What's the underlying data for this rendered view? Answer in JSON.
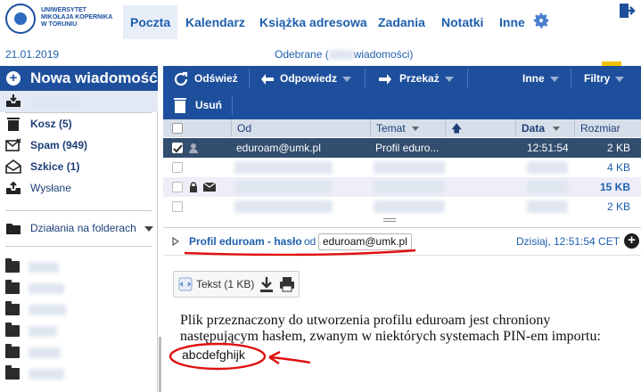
{
  "logo": {
    "lines": [
      "UNIWERSYTET",
      "MIKOŁAJA KOPERNIKA",
      "W TORUNIU"
    ]
  },
  "nav": {
    "tabs": [
      {
        "label": "Poczta"
      },
      {
        "label": "Kalendarz"
      },
      {
        "label": "Książka adresowa"
      },
      {
        "label": "Zadania"
      },
      {
        "label": "Notatki"
      },
      {
        "label": "Inne"
      }
    ]
  },
  "subbar": {
    "date": "21.01.2019",
    "mailbox_prefix": "Odebrane (",
    "mailbox_suffix": "wiadomości)"
  },
  "sidebar": {
    "new_message": "Nowa wiadomość",
    "folders": [
      {
        "label": "Kosz (5)"
      },
      {
        "label": "Spam (949)"
      },
      {
        "label": "Szkice (1)"
      },
      {
        "label": "Wysłane"
      }
    ],
    "actions_label": "Działania na folderach"
  },
  "toolbar": {
    "refresh": "Odśwież",
    "reply": "Odpowiedz",
    "forward": "Przekaż",
    "other": "Inne",
    "filters": "Filtry",
    "delete": "Usuń"
  },
  "table": {
    "headers": {
      "from": "Od",
      "subject": "Temat",
      "date": "Data",
      "size": "Rozmiar"
    },
    "rows": [
      {
        "from": "eduroam@umk.pl",
        "subject": "Profil eduro...",
        "date": "12:51:54",
        "size": "2 KB"
      },
      {
        "from": "",
        "subject": "",
        "date": "",
        "size": "4 KB"
      },
      {
        "from": "",
        "subject": "",
        "date": "",
        "size": "15 KB"
      },
      {
        "from": "",
        "subject": "",
        "date": "",
        "size": "2 KB"
      }
    ]
  },
  "preview": {
    "subject": "Profil eduroam - hasło",
    "from_prefix": "od",
    "from": "eduroam@umk.pl",
    "date": "Dzisiaj, 12:51:54 CET",
    "attachment": "Tekst (1 KB)",
    "body_line1": "Plik przeznaczony do utworzenia profilu eduroam jest chroniony",
    "body_line2": "następującym hasłem, zwanym w niektórych systemach PIN-em importu:",
    "code": "abcdefghijk"
  },
  "colors": {
    "nav_blue": "#1d5fae",
    "toolbar_blue": "#1e4f9c",
    "selected_row": "#324e6e",
    "annotation_red": "#e01010"
  }
}
